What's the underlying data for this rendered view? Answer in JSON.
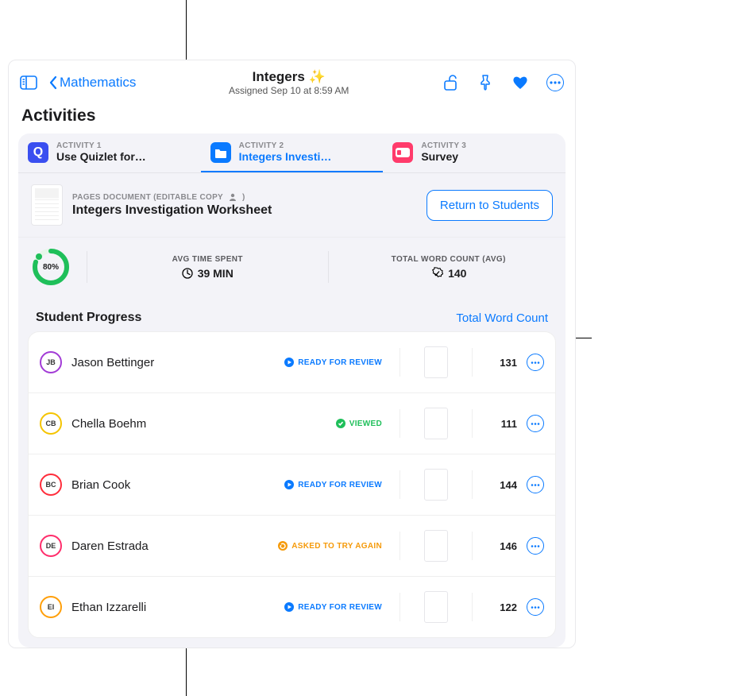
{
  "header": {
    "back_label": "Mathematics",
    "title": "Integers ✨",
    "subtitle": "Assigned Sep 10 at 8:59 AM"
  },
  "section_title": "Activities",
  "tabs": [
    {
      "eyebrow": "ACTIVITY 1",
      "label": "Use Quizlet for…",
      "icon_bg": "#3a4ff0",
      "icon_fg": "#fff",
      "icon_shape": "Q",
      "active": false
    },
    {
      "eyebrow": "ACTIVITY 2",
      "label": "Integers Investi…",
      "icon_bg": "#0a7aff",
      "icon_fg": "#fff",
      "icon_shape": "folder",
      "active": true
    },
    {
      "eyebrow": "ACTIVITY 3",
      "label": "Survey",
      "icon_bg": "#ff3b6b",
      "icon_fg": "#fff",
      "icon_shape": "card",
      "active": false
    }
  ],
  "document": {
    "eyebrow": "PAGES DOCUMENT (EDITABLE COPY",
    "title": "Integers Investigation Worksheet",
    "return_label": "Return to Students"
  },
  "stats": {
    "progress_pct": "80%",
    "avg_time_label": "AVG TIME SPENT",
    "avg_time_value": "39 MIN",
    "word_count_label": "TOTAL WORD COUNT (AVG)",
    "word_count_value": "140"
  },
  "progress_header": {
    "title": "Student Progress",
    "link": "Total Word Count"
  },
  "status_text": {
    "review": "READY FOR REVIEW",
    "viewed": "VIEWED",
    "retry": "ASKED TO TRY AGAIN"
  },
  "students": [
    {
      "initials": "JB",
      "name": "Jason Bettinger",
      "ring": "#a23bd6",
      "status": "review",
      "count": "131"
    },
    {
      "initials": "CB",
      "name": "Chella Boehm",
      "ring": "#f5c400",
      "status": "viewed",
      "count": "111"
    },
    {
      "initials": "BC",
      "name": "Brian Cook",
      "ring": "#ff2d3b",
      "status": "review",
      "count": "144"
    },
    {
      "initials": "DE",
      "name": "Daren Estrada",
      "ring": "#ff2d6b",
      "status": "retry",
      "count": "146"
    },
    {
      "initials": "EI",
      "name": "Ethan Izzarelli",
      "ring": "#ff9f0a",
      "status": "review",
      "count": "122"
    }
  ]
}
